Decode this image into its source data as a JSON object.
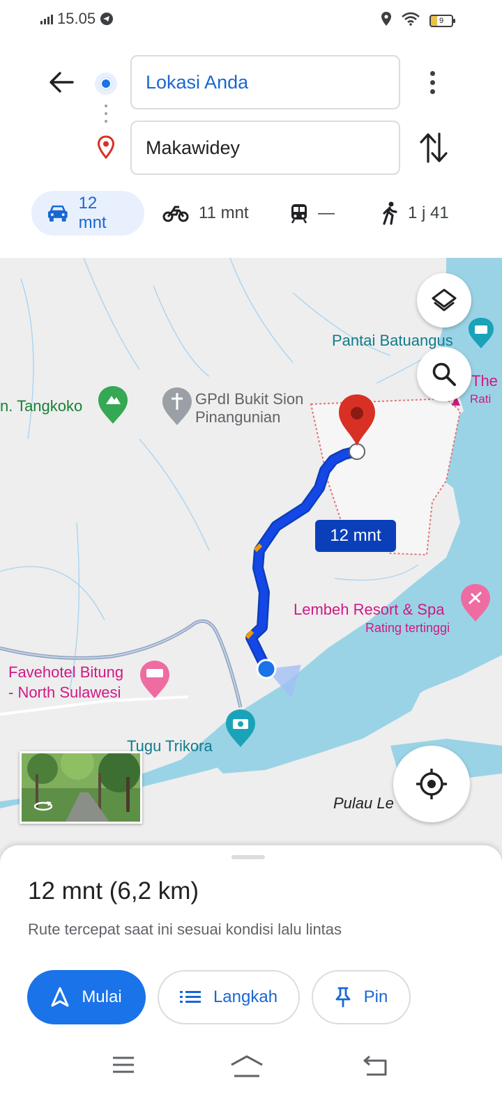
{
  "status_bar": {
    "time": "15.05",
    "battery": "9"
  },
  "directions": {
    "origin": "Lokasi Anda",
    "destination": "Makawidey"
  },
  "modes": [
    {
      "name": "car",
      "time": "12 mnt",
      "active": true
    },
    {
      "name": "motorcycle",
      "time": "11 mnt",
      "active": false
    },
    {
      "name": "transit",
      "time": "—",
      "active": false
    },
    {
      "name": "walk",
      "time": "1 j 41",
      "active": false
    }
  ],
  "map": {
    "labels": {
      "tangkoko": "n. Tangkoko",
      "church": "GPdI Bukit Sion",
      "church_line2": "Pinangunian",
      "pantai": "Pantai Batuangus",
      "the": "The",
      "rati": "Rati",
      "lembeh": "Lembeh Resort & Spa",
      "lembeh_sub": "Rating tertinggi",
      "favehotel": "Favehotel Bitung",
      "favehotel_line2": "- North Sulawesi",
      "tugu": "Tugu Trikora",
      "pulau": "Pulau Le"
    },
    "eta_chip": "12 mnt",
    "icons": [
      "layers-icon",
      "search-icon",
      "my-location-icon"
    ]
  },
  "route": {
    "summary": "12 mnt (6,2 km)",
    "description": "Rute tercepat saat ini sesuai kondisi lalu lintas",
    "buttons": {
      "start": "Mulai",
      "steps": "Langkah",
      "pin": "Pin"
    }
  },
  "colors": {
    "accent": "#1a73e8",
    "route": "#1447e6",
    "destination": "#d93025",
    "water": "#9bd3e6"
  }
}
